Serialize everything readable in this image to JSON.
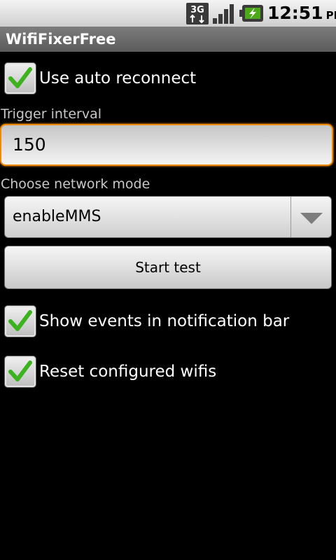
{
  "status_bar": {
    "network_label": "3G",
    "time": "12:51",
    "ampm": "PM",
    "icons": [
      "3g-data-icon",
      "signal-strength-icon",
      "battery-charging-icon"
    ]
  },
  "app": {
    "title": "WifiFixerFree"
  },
  "settings": {
    "auto_reconnect": {
      "label": "Use auto reconnect",
      "checked": true
    },
    "trigger_interval": {
      "label": "Trigger interval",
      "value": "150"
    },
    "network_mode": {
      "label": "Choose network mode",
      "selected": "enableMMS"
    },
    "start_test": {
      "label": "Start test"
    },
    "show_events": {
      "label": "Show events in notification bar",
      "checked": true
    },
    "reset_wifis": {
      "label": "Reset configured wifis",
      "checked": true
    }
  },
  "colors": {
    "background": "#000000",
    "focus_border": "#f08a00",
    "check_green": "#3cb21f",
    "title_bar": "#6b6b6b"
  }
}
